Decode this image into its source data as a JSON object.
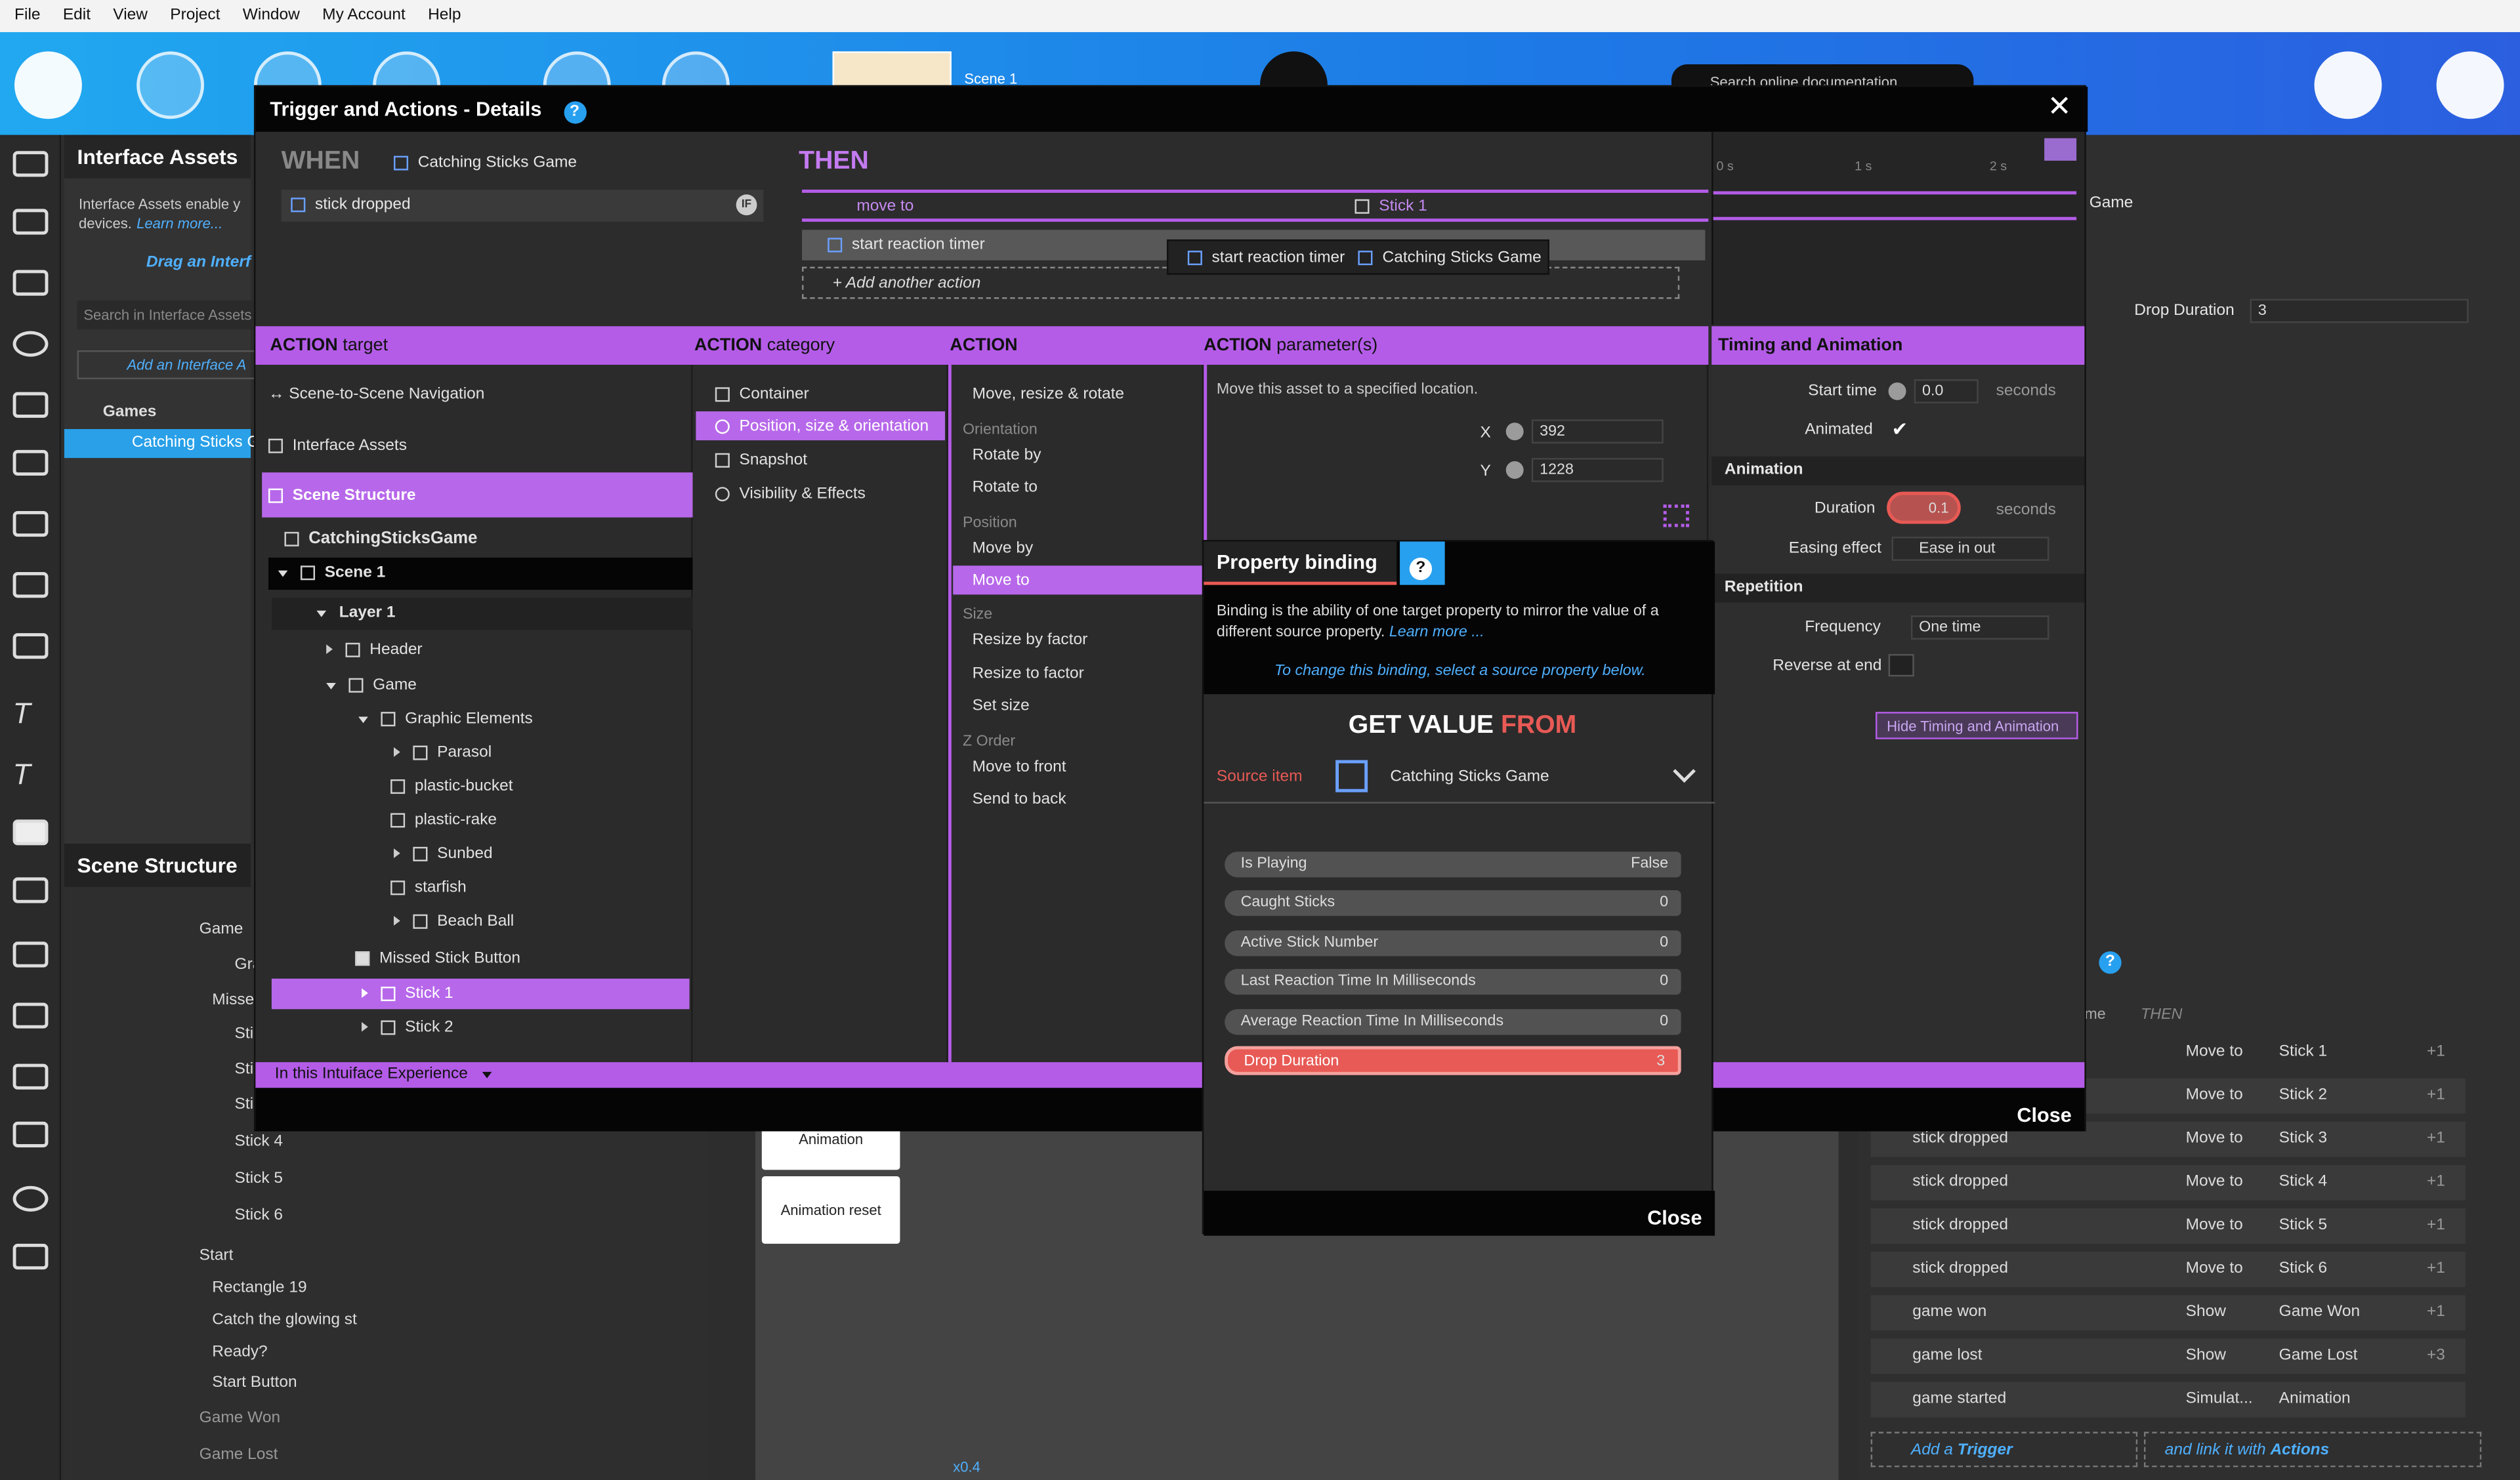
{
  "menu": [
    "File",
    "Edit",
    "View",
    "Project",
    "Window",
    "My Account",
    "Help"
  ],
  "topbar": {
    "search_placeholder": "Search online documentation",
    "scene_label": "Scene 1"
  },
  "left_panel": {
    "title": "Interface Assets",
    "desc": "Interface Assets enable y",
    "desc2": "devices.",
    "learn": "Learn more...",
    "drag": "Drag an Interf",
    "search": "Search in Interface Assets",
    "add": "Add an Interface A",
    "games": "Games",
    "catching": "Catching Sticks G"
  },
  "scene_structure": {
    "title": "Scene Structure",
    "rows": [
      {
        "label": "Game",
        "indent": 0
      },
      {
        "label": "Gra",
        "indent": 1
      },
      {
        "label": "Misse",
        "indent": 1
      },
      {
        "label": "Sti",
        "indent": 1
      },
      {
        "label": "Sti",
        "indent": 1
      },
      {
        "label": "Sti",
        "indent": 1
      },
      {
        "label": "Stick 4",
        "indent": 1
      },
      {
        "label": "Stick 5",
        "indent": 1
      },
      {
        "label": "Stick 6",
        "indent": 1
      },
      {
        "label": "Start",
        "indent": 0
      },
      {
        "label": "Rectangle 19",
        "indent": 1
      },
      {
        "label": "Catch the glowing st",
        "indent": 1
      },
      {
        "label": "Ready?",
        "indent": 1
      },
      {
        "label": "Start Button",
        "indent": 1
      },
      {
        "label": "Game Won",
        "indent": 0
      },
      {
        "label": "Game Lost",
        "indent": 0
      }
    ]
  },
  "canvas": {
    "btn1": "Animation",
    "btn2": "Animation reset",
    "zoom": "x0.4"
  },
  "right_bg": {
    "game": "Game",
    "drop_duration_label": "Drop Duration",
    "drop_duration_value": "3",
    "col_me": "me",
    "col_then": "THEN",
    "rows": [
      {
        "trigger": "",
        "action": "Move to",
        "target": "Stick 1",
        "extra": "+1"
      },
      {
        "trigger": "",
        "action": "Move to",
        "target": "Stick 2",
        "extra": "+1"
      },
      {
        "trigger": "stick dropped",
        "action": "Move to",
        "target": "Stick 3",
        "extra": "+1"
      },
      {
        "trigger": "stick dropped",
        "action": "Move to",
        "target": "Stick 4",
        "extra": "+1"
      },
      {
        "trigger": "stick dropped",
        "action": "Move to",
        "target": "Stick 5",
        "extra": "+1"
      },
      {
        "trigger": "stick dropped",
        "action": "Move to",
        "target": "Stick 6",
        "extra": "+1"
      },
      {
        "trigger": "game won",
        "action": "Show",
        "target": "Game Won",
        "extra": "+1"
      },
      {
        "trigger": "game lost",
        "action": "Show",
        "target": "Game Lost",
        "extra": "+3"
      },
      {
        "trigger": "game started",
        "action": "Simulat...",
        "target": "Animation",
        "extra": ""
      }
    ],
    "add_trigger_prefix": "Add a",
    "add_trigger": "Trigger",
    "link_prefix": "and link it with",
    "link": "Actions"
  },
  "dialog": {
    "title": "Trigger and Actions - Details",
    "when": "WHEN",
    "when_source": "Catching Sticks Game",
    "trigger": "stick dropped",
    "then": "THEN",
    "action1": "move to",
    "action1_target": "Stick 1",
    "action2": "start reaction timer",
    "add_action": "Add another action",
    "tooltip_action": "start reaction timer",
    "tooltip_target": "Catching Sticks Game",
    "timeline": {
      "t0": "0 s",
      "t1": "1 s",
      "t2": "2 s"
    },
    "headers": {
      "target_b": "ACTION",
      "target": "target",
      "category_b": "ACTION",
      "category": "category",
      "action": "ACTION",
      "param_b": "ACTION",
      "param": "parameter(s)",
      "timing": "Timing and Animation"
    },
    "targets": {
      "nav": "Scene-to-Scene Navigation",
      "assets": "Interface Assets",
      "structure": "Scene Structure",
      "root": "CatchingSticksGame",
      "scene": "Scene 1",
      "layer": "Layer 1",
      "header": "Header",
      "game": "Game",
      "graphic": "Graphic Elements",
      "parasol": "Parasol",
      "bucket": "plastic-bucket",
      "rake": "plastic-rake",
      "sunbed": "Sunbed",
      "starfish": "starfish",
      "ball": "Beach Ball",
      "missed": "Missed Stick Button",
      "stick1": "Stick 1",
      "stick2": "Stick 2"
    },
    "categories": [
      "Container",
      "Position, size & orientation",
      "Snapshot",
      "Visibility & Effects"
    ],
    "actions": {
      "move": "Move, resize & rotate",
      "g_orient": "Orientation",
      "rotate_by": "Rotate by",
      "rotate_to": "Rotate to",
      "g_pos": "Position",
      "move_by": "Move by",
      "move_to": "Move to",
      "g_size": "Size",
      "resize_by": "Resize by factor",
      "resize_to": "Resize to factor",
      "set_size": "Set size",
      "g_z": "Z Order",
      "front": "Move to front",
      "back": "Send to back"
    },
    "params": {
      "desc": "Move this asset to a specified location.",
      "x_label": "X",
      "x": "392",
      "y_label": "Y",
      "y": "1228"
    },
    "timing": {
      "start_label": "Start time",
      "start": "0.0",
      "seconds": "seconds",
      "animated": "Animated",
      "animation": "Animation",
      "duration_label": "Duration",
      "duration": "0.1",
      "easing_label": "Easing effect",
      "easing": "Ease in out",
      "repetition": "Repetition",
      "freq_label": "Frequency",
      "freq": "One time",
      "reverse": "Reverse at end",
      "hide": "Hide Timing and Animation"
    },
    "footer": "In this Intuiface Experience",
    "close": "Close"
  },
  "binding": {
    "title": "Property binding",
    "desc": "Binding is the ability of one target property to mirror the value of a different source property.",
    "learn": "Learn more ...",
    "hint": "To change this binding, select a source property below.",
    "get": "GET VALUE",
    "from": "FROM",
    "source_label": "Source item",
    "source": "Catching Sticks Game",
    "props": [
      {
        "name": "Is Playing",
        "value": "False"
      },
      {
        "name": "Caught Sticks",
        "value": "0"
      },
      {
        "name": "Active Stick Number",
        "value": "0"
      },
      {
        "name": "Last Reaction Time In Milliseconds",
        "value": "0"
      },
      {
        "name": "Average Reaction Time In Milliseconds",
        "value": "0"
      },
      {
        "name": "Drop Duration",
        "value": "3"
      }
    ],
    "close": "Close"
  },
  "colors": {
    "accent": "#b45ce8",
    "highlight": "#e85a55",
    "topbar": "#1d7ae6"
  }
}
